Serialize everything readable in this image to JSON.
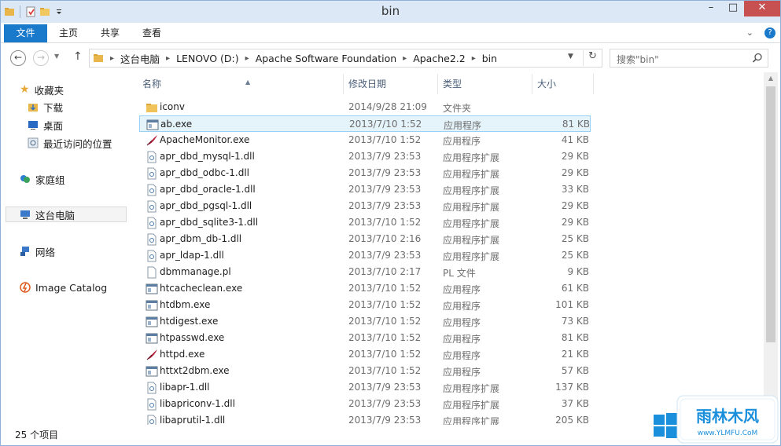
{
  "window": {
    "title": "bin"
  },
  "ribbon": {
    "tabs": [
      "文件",
      "主页",
      "共享",
      "查看"
    ]
  },
  "address": {
    "crumbs": [
      "这台电脑",
      "LENOVO (D:)",
      "Apache Software Foundation",
      "Apache2.2",
      "bin"
    ]
  },
  "search": {
    "placeholder": "搜索\"bin\""
  },
  "nav": {
    "favorites": "收藏夹",
    "downloads": "下载",
    "desktop": "桌面",
    "recent": "最近访问的位置",
    "homegroup": "家庭组",
    "thispc": "这台电脑",
    "network": "网络",
    "imagecatalog": "Image Catalog"
  },
  "columns": {
    "name": "名称",
    "date": "修改日期",
    "type": "类型",
    "size": "大小"
  },
  "files": [
    {
      "name": "iconv",
      "date": "2014/9/28 21:09",
      "type": "文件夹",
      "size": "",
      "icon": "folder-icon"
    },
    {
      "name": "ab.exe",
      "date": "2013/7/10 1:52",
      "type": "应用程序",
      "size": "81 KB",
      "icon": "exe-icon"
    },
    {
      "name": "ApacheMonitor.exe",
      "date": "2013/7/10 1:52",
      "type": "应用程序",
      "size": "41 KB",
      "icon": "feather-icon"
    },
    {
      "name": "apr_dbd_mysql-1.dll",
      "date": "2013/7/9 23:53",
      "type": "应用程序扩展",
      "size": "29 KB",
      "icon": "dll-icon"
    },
    {
      "name": "apr_dbd_odbc-1.dll",
      "date": "2013/7/9 23:53",
      "type": "应用程序扩展",
      "size": "29 KB",
      "icon": "dll-icon"
    },
    {
      "name": "apr_dbd_oracle-1.dll",
      "date": "2013/7/9 23:53",
      "type": "应用程序扩展",
      "size": "33 KB",
      "icon": "dll-icon"
    },
    {
      "name": "apr_dbd_pgsql-1.dll",
      "date": "2013/7/9 23:53",
      "type": "应用程序扩展",
      "size": "29 KB",
      "icon": "dll-icon"
    },
    {
      "name": "apr_dbd_sqlite3-1.dll",
      "date": "2013/7/10 1:52",
      "type": "应用程序扩展",
      "size": "29 KB",
      "icon": "dll-icon"
    },
    {
      "name": "apr_dbm_db-1.dll",
      "date": "2013/7/10 2:16",
      "type": "应用程序扩展",
      "size": "25 KB",
      "icon": "dll-icon"
    },
    {
      "name": "apr_ldap-1.dll",
      "date": "2013/7/9 23:53",
      "type": "应用程序扩展",
      "size": "25 KB",
      "icon": "dll-icon"
    },
    {
      "name": "dbmmanage.pl",
      "date": "2013/7/10 2:17",
      "type": "PL 文件",
      "size": "9 KB",
      "icon": "file-icon"
    },
    {
      "name": "htcacheclean.exe",
      "date": "2013/7/10 1:52",
      "type": "应用程序",
      "size": "61 KB",
      "icon": "exe-icon"
    },
    {
      "name": "htdbm.exe",
      "date": "2013/7/10 1:52",
      "type": "应用程序",
      "size": "101 KB",
      "icon": "exe-icon"
    },
    {
      "name": "htdigest.exe",
      "date": "2013/7/10 1:52",
      "type": "应用程序",
      "size": "73 KB",
      "icon": "exe-icon"
    },
    {
      "name": "htpasswd.exe",
      "date": "2013/7/10 1:52",
      "type": "应用程序",
      "size": "81 KB",
      "icon": "exe-icon"
    },
    {
      "name": "httpd.exe",
      "date": "2013/7/10 1:52",
      "type": "应用程序",
      "size": "21 KB",
      "icon": "feather-icon"
    },
    {
      "name": "httxt2dbm.exe",
      "date": "2013/7/10 1:52",
      "type": "应用程序",
      "size": "57 KB",
      "icon": "exe-icon"
    },
    {
      "name": "libapr-1.dll",
      "date": "2013/7/9 23:53",
      "type": "应用程序扩展",
      "size": "137 KB",
      "icon": "dll-icon"
    },
    {
      "name": "libapriconv-1.dll",
      "date": "2013/7/9 23:53",
      "type": "应用程序扩展",
      "size": "37 KB",
      "icon": "dll-icon"
    },
    {
      "name": "libaprutil-1.dll",
      "date": "2013/7/9 23:53",
      "type": "应用程序扩展",
      "size": "205 KB",
      "icon": "dll-icon"
    }
  ],
  "selected_file": "ab.exe",
  "status": {
    "count": "25 个项目"
  },
  "watermark": {
    "text": "雨林木风",
    "url": "www.YLMFU.CoM"
  },
  "colors": {
    "accent": "#1979ca",
    "selection": "#e5f3fb",
    "selection_border": "#99d1f6"
  }
}
